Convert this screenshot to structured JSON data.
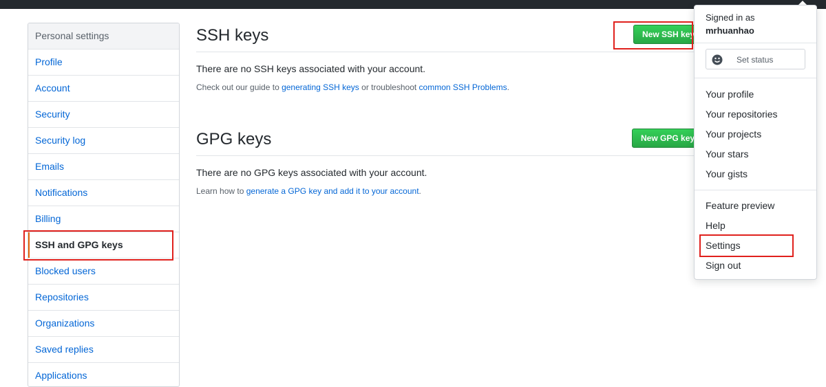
{
  "sidebar": {
    "header": "Personal settings",
    "items": [
      {
        "label": "Profile",
        "selected": false
      },
      {
        "label": "Account",
        "selected": false
      },
      {
        "label": "Security",
        "selected": false
      },
      {
        "label": "Security log",
        "selected": false
      },
      {
        "label": "Emails",
        "selected": false
      },
      {
        "label": "Notifications",
        "selected": false
      },
      {
        "label": "Billing",
        "selected": false
      },
      {
        "label": "SSH and GPG keys",
        "selected": true
      },
      {
        "label": "Blocked users",
        "selected": false
      },
      {
        "label": "Repositories",
        "selected": false
      },
      {
        "label": "Organizations",
        "selected": false
      },
      {
        "label": "Saved replies",
        "selected": false
      },
      {
        "label": "Applications",
        "selected": false
      }
    ]
  },
  "ssh": {
    "title": "SSH keys",
    "button": "New SSH key",
    "empty_text": "There are no SSH keys associated with your account.",
    "note_prefix": "Check out our guide to ",
    "note_link1": "generating SSH keys",
    "note_middle": " or troubleshoot ",
    "note_link2": "common SSH Problems",
    "note_suffix": "."
  },
  "gpg": {
    "title": "GPG keys",
    "button": "New GPG key",
    "empty_text": "There are no GPG keys associated with your account.",
    "note_prefix": "Learn how to ",
    "note_link": "generate a GPG key and add it to your account",
    "note_suffix": "."
  },
  "dropdown": {
    "signed_in_as": "Signed in as",
    "username": "mrhuanhao",
    "set_status": "Set status",
    "group1": [
      "Your profile",
      "Your repositories",
      "Your projects",
      "Your stars",
      "Your gists"
    ],
    "group2": [
      "Feature preview",
      "Help",
      "Settings",
      "Sign out"
    ]
  },
  "colors": {
    "link": "#0366d6",
    "button_green": "#28a745",
    "annotation_red": "#e0201c",
    "topbar": "#24292e"
  }
}
